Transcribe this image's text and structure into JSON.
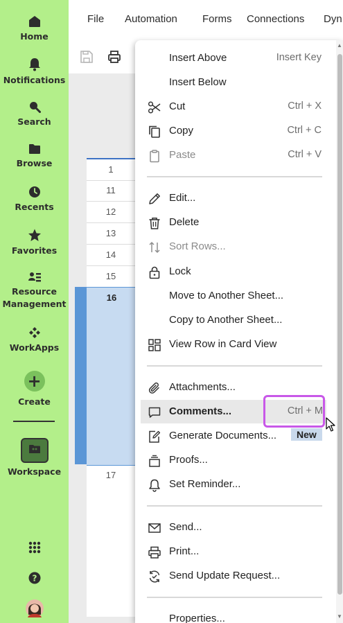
{
  "nav": {
    "home": "Home",
    "notifications": "Notifications",
    "search": "Search",
    "browse": "Browse",
    "recents": "Recents",
    "favorites": "Favorites",
    "resource_line1": "Resource",
    "resource_line2": "Management",
    "workapps": "WorkApps",
    "create": "Create",
    "workspace": "Workspace"
  },
  "menubar": {
    "file": "File",
    "automation": "Automation",
    "forms": "Forms",
    "connections": "Connections",
    "dyn": "Dyn"
  },
  "rows": [
    "1",
    "11",
    "12",
    "13",
    "14",
    "15",
    "16",
    "17"
  ],
  "context_menu": {
    "insert_above": "Insert Above",
    "insert_above_sc": "Insert Key",
    "insert_below": "Insert Below",
    "cut": "Cut",
    "cut_sc": "Ctrl + X",
    "copy": "Copy",
    "copy_sc": "Ctrl + C",
    "paste": "Paste",
    "paste_sc": "Ctrl + V",
    "edit": "Edit...",
    "delete": "Delete",
    "sort_rows": "Sort Rows...",
    "lock": "Lock",
    "move_sheet": "Move to Another Sheet...",
    "copy_sheet": "Copy to Another Sheet...",
    "card_view": "View Row in Card View",
    "attachments": "Attachments...",
    "comments": "Comments...",
    "comments_sc": "Ctrl + M",
    "generate_docs": "Generate Documents...",
    "new_badge": "New",
    "proofs": "Proofs...",
    "set_reminder": "Set Reminder...",
    "send": "Send...",
    "print": "Print...",
    "send_update": "Send Update Request...",
    "properties": "Properties..."
  },
  "colors": {
    "nav_bg": "#b3ef8a",
    "highlight": "#c858e8",
    "selection": "#c7dbf1",
    "selection_bar": "#5b96d6"
  }
}
